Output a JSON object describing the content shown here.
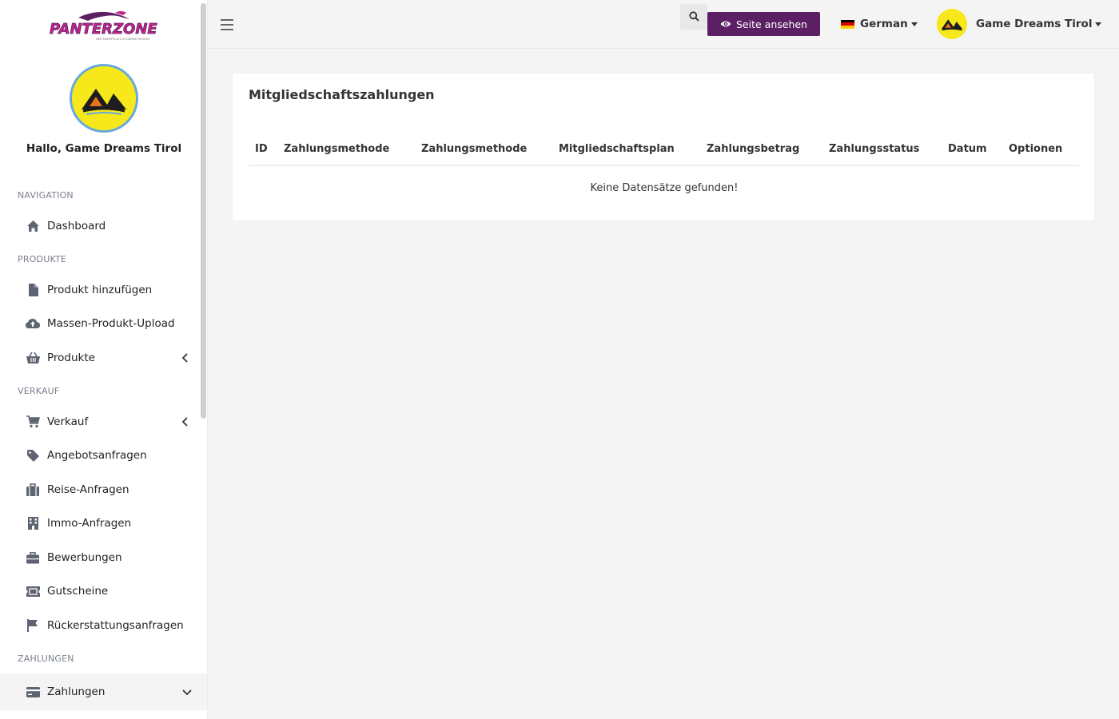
{
  "brand": {
    "logo_text": "PANTERZONE",
    "logo_tagline": "DER MARKTPLATZ IN DEINER REGION"
  },
  "colors": {
    "accent": "#5c1f63",
    "logo_pink": "#c2258a",
    "avatar_yellow": "#f6e81a"
  },
  "sidebar": {
    "greeting": "Hallo, Game Dreams Tirol",
    "sections": [
      {
        "title": "NAVIGATION",
        "items": [
          {
            "label": "Dashboard",
            "icon": "home-icon"
          }
        ]
      },
      {
        "title": "PRODUKTE",
        "items": [
          {
            "label": "Produkt hinzufügen",
            "icon": "file-icon"
          },
          {
            "label": "Massen-Produkt-Upload",
            "icon": "cloud-upload-icon"
          },
          {
            "label": "Produkte",
            "icon": "basket-icon",
            "expandable": true
          }
        ]
      },
      {
        "title": "VERKAUF",
        "items": [
          {
            "label": "Verkauf",
            "icon": "cart-icon",
            "expandable": true
          },
          {
            "label": "Angebotsanfragen",
            "icon": "tag-icon"
          },
          {
            "label": "Reise-Anfragen",
            "icon": "suitcase-icon"
          },
          {
            "label": "Immo-Anfragen",
            "icon": "building-icon"
          },
          {
            "label": "Bewerbungen",
            "icon": "briefcase-icon"
          },
          {
            "label": "Gutscheine",
            "icon": "ticket-icon"
          },
          {
            "label": "Rückerstattungsanfragen",
            "icon": "flag-icon"
          }
        ]
      },
      {
        "title": "ZAHLUNGEN",
        "items": [
          {
            "label": "Zahlungen",
            "icon": "credit-card-icon",
            "expandable": true,
            "expanded": true,
            "active": true
          }
        ]
      }
    ]
  },
  "topbar": {
    "view_site_label": "Seite ansehen",
    "language_label": "German",
    "user_name": "Game Dreams Tirol"
  },
  "main": {
    "card_title": "Mitgliedschaftszahlungen",
    "columns": [
      "ID",
      "Zahlungsmethode",
      "Zahlungsmethode",
      "Mitgliedschaftsplan",
      "Zahlungsbetrag",
      "Zahlungsstatus",
      "Datum",
      "Optionen"
    ],
    "empty_message": "Keine Datensätze gefunden!"
  }
}
